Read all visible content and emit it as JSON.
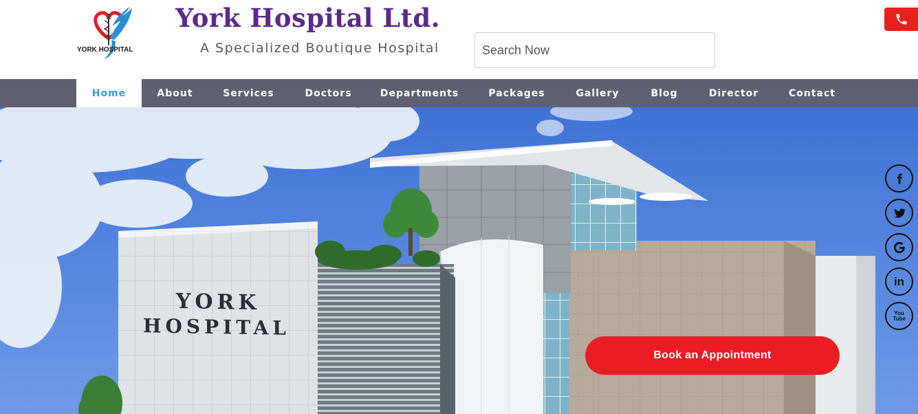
{
  "header": {
    "logo_text": "YORK HOSPITAL",
    "title": "York Hospital Ltd.",
    "tagline": "A Specialized Boutique Hospital",
    "search_placeholder": "Search Now",
    "phone_icon": "phone-icon"
  },
  "nav": {
    "items": [
      {
        "label": "Home",
        "active": true
      },
      {
        "label": "About"
      },
      {
        "label": "Services"
      },
      {
        "label": "Doctors"
      },
      {
        "label": "Departments"
      },
      {
        "label": "Packages"
      },
      {
        "label": "Gallery"
      },
      {
        "label": "Blog"
      },
      {
        "label": "Director"
      },
      {
        "label": "Contact"
      }
    ]
  },
  "hero": {
    "building_sign_line1": "YORK",
    "building_sign_line2": "HOSPITAL",
    "book_button": "Book an Appointment"
  },
  "social": {
    "icons": [
      "facebook-icon",
      "twitter-icon",
      "google-icon",
      "linkedin-icon",
      "youtube-icon"
    ],
    "labels": [
      "f",
      "in",
      "You Tube"
    ]
  },
  "colors": {
    "brand_purple": "#5a2a8a",
    "nav_bg": "#5f6173",
    "nav_active_text": "#3a9bd8",
    "accent_red": "#ec1c24"
  }
}
